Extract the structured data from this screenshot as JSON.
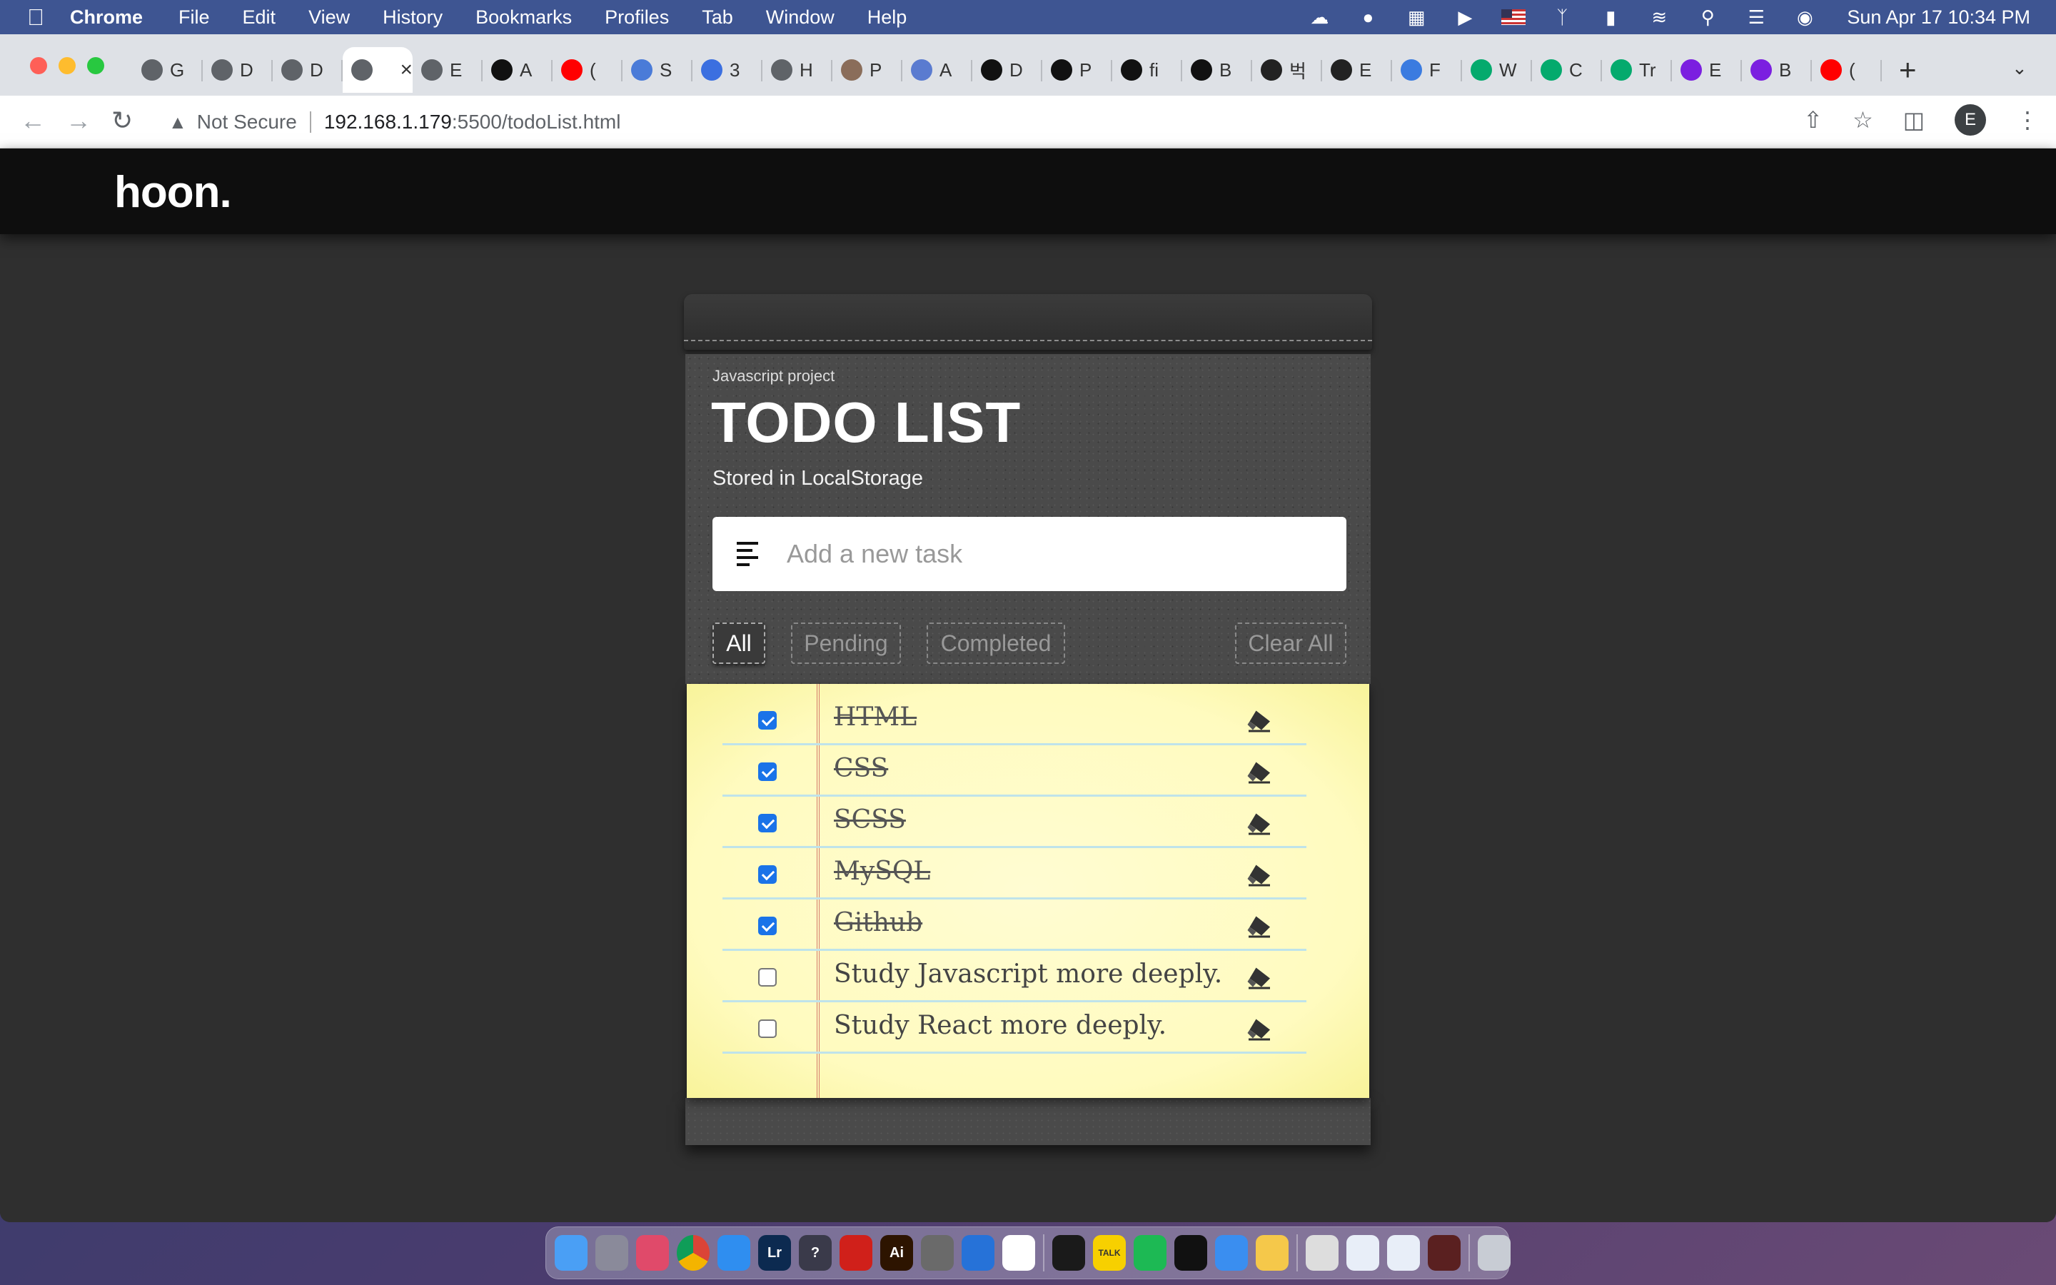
{
  "menubar": {
    "app_name": "Chrome",
    "items": [
      "File",
      "Edit",
      "View",
      "History",
      "Bookmarks",
      "Profiles",
      "Tab",
      "Window",
      "Help"
    ],
    "clock": "Sun Apr 17  10:34 PM"
  },
  "browser": {
    "tabs": [
      {
        "label": "G",
        "icon": "globe-icon"
      },
      {
        "label": "D",
        "icon": "globe-icon"
      },
      {
        "label": "D",
        "icon": "globe-icon"
      },
      {
        "label": "",
        "icon": "globe-icon",
        "active": true
      },
      {
        "label": "E",
        "icon": "globe-icon"
      },
      {
        "label": "A",
        "icon": "bars-icon"
      },
      {
        "label": "(",
        "icon": "youtube-icon"
      },
      {
        "label": "S",
        "icon": "flag-icon"
      },
      {
        "label": "3",
        "icon": "diamond-icon"
      },
      {
        "label": "H",
        "icon": "globe-icon"
      },
      {
        "label": "P",
        "icon": "avatar-icon"
      },
      {
        "label": "A",
        "icon": "triangle-icon"
      },
      {
        "label": "D",
        "icon": "logo-icon"
      },
      {
        "label": "P",
        "icon": "logo-icon"
      },
      {
        "label": "fi",
        "icon": "logo-icon"
      },
      {
        "label": "B",
        "icon": "logo-icon"
      },
      {
        "label": "벅",
        "icon": "wix-icon"
      },
      {
        "label": "E",
        "icon": "wix-icon"
      },
      {
        "label": "F",
        "icon": "bot-icon"
      },
      {
        "label": "W",
        "icon": "w3-icon"
      },
      {
        "label": "C",
        "icon": "w3-icon"
      },
      {
        "label": "Tr",
        "icon": "w3-icon"
      },
      {
        "label": "E",
        "icon": "bootstrap-icon"
      },
      {
        "label": "B",
        "icon": "bootstrap-icon"
      },
      {
        "label": "(",
        "icon": "youtube-icon"
      }
    ],
    "security_label": "Not Secure",
    "url_host": "192.168.1.179",
    "url_path": ":5500/todoList.html",
    "profile_initial": "E"
  },
  "site": {
    "logo": "hoon."
  },
  "todo": {
    "subtitle": "Javascript project",
    "title": "TODO LIST",
    "storage_note": "Stored in LocalStorage",
    "input_placeholder": "Add a new task",
    "filters": {
      "all": "All",
      "pending": "Pending",
      "completed": "Completed",
      "clear": "Clear All"
    },
    "active_filter": "all",
    "tasks": [
      {
        "text": "HTML",
        "done": true
      },
      {
        "text": "CSS",
        "done": true
      },
      {
        "text": "SCSS",
        "done": true
      },
      {
        "text": "MySQL",
        "done": true
      },
      {
        "text": "Github",
        "done": true
      },
      {
        "text": "Study Javascript more deeply.",
        "done": false
      },
      {
        "text": "Study React more deeply.",
        "done": false
      }
    ]
  },
  "colors": {
    "header_bg": "#0e0e0e",
    "paper": "#fffbc0",
    "checkbox_on": "#1a73e8"
  },
  "dock_apps": [
    "Finder",
    "Launchpad",
    "Creative Cloud",
    "Chrome",
    "App Store",
    "Lr",
    "?",
    "Acrobat",
    "Ai",
    "Settings",
    "VS Code",
    "Calendar",
    "Terminal",
    "TALK",
    "Spotify",
    "iTerm",
    "Mail",
    "Notes",
    "Preview",
    "Files",
    "Files",
    "Photo Booth",
    "Trash"
  ]
}
